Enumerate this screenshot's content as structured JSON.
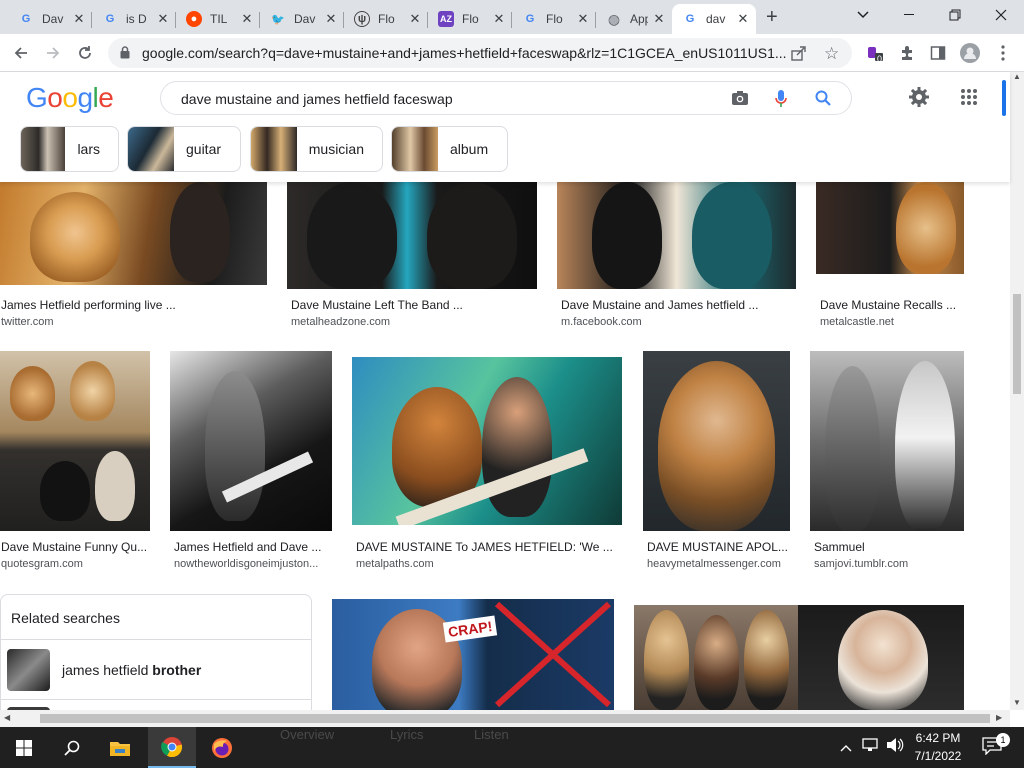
{
  "tabs": [
    {
      "title": "Dav",
      "favicon": "google-icon",
      "color": "#4285f4"
    },
    {
      "title": "is D",
      "favicon": "google-icon",
      "color": "#4285f4"
    },
    {
      "title": "TIL",
      "favicon": "reddit-icon",
      "color": "#ff4500"
    },
    {
      "title": "Dav",
      "favicon": "twitter-icon",
      "color": "#1da1f2"
    },
    {
      "title": "Flo",
      "favicon": "flotsam-icon",
      "color": "#444"
    },
    {
      "title": "Flo",
      "favicon": "az-icon",
      "color": "#6f42c1"
    },
    {
      "title": "Flo",
      "favicon": "google-icon",
      "color": "#4285f4"
    },
    {
      "title": "App",
      "favicon": "globe-icon",
      "color": "#5f6368"
    },
    {
      "title": "dav",
      "favicon": "google-icon",
      "color": "#4285f4",
      "active": true
    }
  ],
  "address": {
    "url": "google.com/search?q=dave+mustaine+and+james+hetfield+faceswap&rlz=1C1GCEA_enUS1011US1..."
  },
  "extensions": {
    "badge": "0"
  },
  "search": {
    "logo": "Google",
    "query": "dave mustaine and james hetfield faceswap"
  },
  "chips": [
    {
      "label": "lars"
    },
    {
      "label": "guitar"
    },
    {
      "label": "musician"
    },
    {
      "label": "album"
    }
  ],
  "results": {
    "row1": [
      {
        "caption": "James Hetfield performing live ...",
        "source": "twitter.com"
      },
      {
        "caption": "Dave Mustaine Left The Band ...",
        "source": "metalheadzone.com"
      },
      {
        "caption": "Dave Mustaine and James hetfield ...",
        "source": "m.facebook.com"
      },
      {
        "caption": "Dave Mustaine Recalls ...",
        "source": "metalcastle.net"
      }
    ],
    "row2": [
      {
        "caption": "Dave Mustaine Funny Qu...",
        "source": "quotesgram.com"
      },
      {
        "caption": "James Hetfield and Dave ...",
        "source": "nowtheworldisgoneimjuston..."
      },
      {
        "caption": "DAVE MUSTAINE To JAMES HETFIELD: 'We ...",
        "source": "metalpaths.com"
      },
      {
        "caption": "DAVE MUSTAINE APOL...",
        "source": "heavymetalmessenger.com"
      },
      {
        "caption": "Sammuel",
        "source": "samjovi.tumblr.com"
      }
    ],
    "row3_overlay": {
      "crap_text": "CRAP!"
    }
  },
  "related": {
    "heading": "Related searches",
    "item_prefix": "james hetfield ",
    "item_bold": "brother"
  },
  "taskbar": {
    "time": "6:42 PM",
    "date": "7/1/2022",
    "ghost": {
      "overview": "Overview",
      "lyrics": "Lyrics",
      "listen": "Listen"
    }
  }
}
